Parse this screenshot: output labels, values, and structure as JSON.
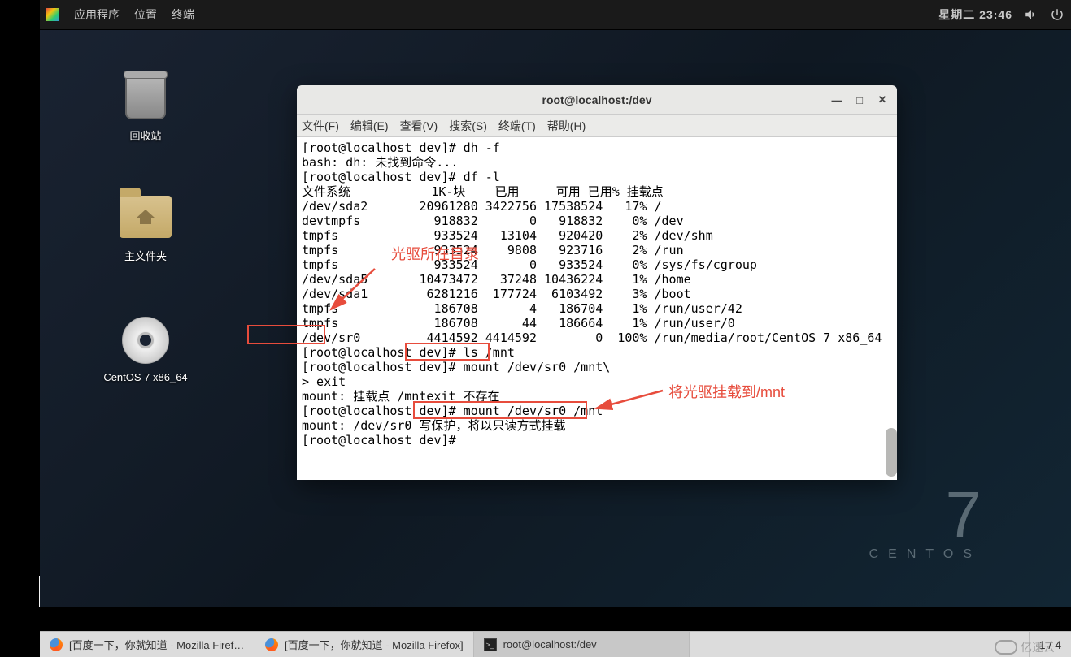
{
  "topbar": {
    "applications": "应用程序",
    "places": "位置",
    "terminal": "终端",
    "clock": "星期二 23:46"
  },
  "desktop_icons": {
    "trash": "回收站",
    "home": "主文件夹",
    "disc": "CentOS 7 x86_64"
  },
  "centos": {
    "num": "7",
    "word": "CENTOS"
  },
  "terminal": {
    "title": "root@localhost:/dev",
    "menu": {
      "file": "文件(F)",
      "edit": "编辑(E)",
      "view": "查看(V)",
      "search": "搜索(S)",
      "terminal": "终端(T)",
      "help": "帮助(H)"
    },
    "content": "[root@localhost dev]# dh -f\nbash: dh: 未找到命令...\n[root@localhost dev]# df -l\n文件系统           1K-块    已用     可用 已用% 挂载点\n/dev/sda2       20961280 3422756 17538524   17% /\ndevtmpfs          918832       0   918832    0% /dev\ntmpfs             933524   13104   920420    2% /dev/shm\ntmpfs             933524    9808   923716    2% /run\ntmpfs             933524       0   933524    0% /sys/fs/cgroup\n/dev/sda5       10473472   37248 10436224    1% /home\n/dev/sda1        6281216  177724  6103492    3% /boot\ntmpfs             186708       4   186704    1% /run/user/42\ntmpfs             186708      44   186664    1% /run/user/0\n/dev/sr0         4414592 4414592        0  100% /run/media/root/CentOS 7 x86_64\n[root@localhost dev]# ls /mnt\n[root@localhost dev]# mount /dev/sr0 /mnt\\\n> exit\nmount: 挂载点 /mntexit 不存在\n[root@localhost dev]# mount /dev/sr0 /mnt\nmount: /dev/sr0 写保护，将以只读方式挂载\n[root@localhost dev]# "
  },
  "annotations": {
    "label1": "光驱所在目录",
    "label2": "将光驱挂载到/mnt"
  },
  "taskbar": {
    "item1": "[百度一下，你就知道 - Mozilla Firef…",
    "item2": "[百度一下，你就知道 - Mozilla Firefox]",
    "item3": "root@localhost:/dev",
    "pages": "1 / 4"
  },
  "watermark": "亿速云"
}
